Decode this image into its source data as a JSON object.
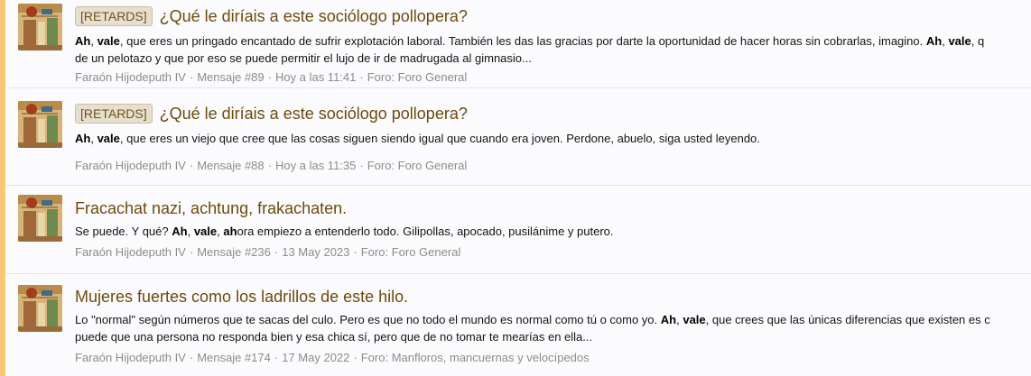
{
  "results": [
    {
      "prefix": "[RETARDS]",
      "title": "¿Qué le diríais a este sociólogo pollopera?",
      "snippet_line1": [
        {
          "t": "Ah",
          "b": true
        },
        {
          "t": ", ",
          "b": false
        },
        {
          "t": "vale",
          "b": true
        },
        {
          "t": ", que eres un pringado encantado de sufrir explotación laboral. También les das las gracias por darte la oportunidad de hacer horas sin cobrarlas, imagino. ",
          "b": false
        },
        {
          "t": "Ah",
          "b": true
        },
        {
          "t": ", ",
          "b": false
        },
        {
          "t": "vale",
          "b": true
        },
        {
          "t": ", q",
          "b": false
        }
      ],
      "snippet_line2": [
        {
          "t": "de un pelotazo y que por eso se puede permitir el lujo de ir de madrugada al gimnasio...",
          "b": false
        }
      ],
      "author": "Faraón Hijodeputh IV",
      "message": "Mensaje #89",
      "date": "Hoy a las 11:41",
      "forum": "Foro: Foro General"
    },
    {
      "prefix": "[RETARDS]",
      "title": "¿Qué le diríais a este sociólogo pollopera?",
      "snippet_line1": [
        {
          "t": "Ah",
          "b": true
        },
        {
          "t": ", ",
          "b": false
        },
        {
          "t": "vale",
          "b": true
        },
        {
          "t": ", que eres un viejo que cree que las cosas siguen siendo igual que cuando era joven. Perdone, abuelo, siga usted leyendo.",
          "b": false
        }
      ],
      "snippet_line2": [],
      "author": "Faraón Hijodeputh IV",
      "message": "Mensaje #88",
      "date": "Hoy a las 11:35",
      "forum": "Foro: Foro General"
    },
    {
      "prefix": "",
      "title": "Fracachat nazi, achtung, frakachaten.",
      "snippet_line1": [
        {
          "t": "Se puede. Y qué? ",
          "b": false
        },
        {
          "t": "Ah",
          "b": true
        },
        {
          "t": ", ",
          "b": false
        },
        {
          "t": "vale",
          "b": true
        },
        {
          "t": ", ",
          "b": false
        },
        {
          "t": "ah",
          "b": true
        },
        {
          "t": "ora empiezo a entenderlo todo. Gilipollas, apocado, pusilánime y putero.",
          "b": false
        }
      ],
      "snippet_line2": [],
      "author": "Faraón Hijodeputh IV",
      "message": "Mensaje #236",
      "date": "13 May 2023",
      "forum": "Foro: Foro General"
    },
    {
      "prefix": "",
      "title": "Mujeres fuertes como los ladrillos de este hilo.",
      "snippet_line1": [
        {
          "t": "Lo \"normal\" según números que te sacas del culo. Pero es que no todo el mundo es normal como tú o como yo. ",
          "b": false
        },
        {
          "t": "Ah",
          "b": true
        },
        {
          "t": ", ",
          "b": false
        },
        {
          "t": "vale",
          "b": true
        },
        {
          "t": ", que crees que las únicas diferencias que existen es c",
          "b": false
        }
      ],
      "snippet_line2": [
        {
          "t": "puede que una persona no responda bien y esa chica sí, pero que de no tomar te mearías en ella...",
          "b": false
        }
      ],
      "author": "Faraón Hijodeputh IV",
      "message": "Mensaje #174",
      "date": "17 May 2022",
      "forum": "Foro: Manfloros, mancuernas y velocípedos"
    }
  ],
  "meta_separator": "·",
  "colors": {
    "stripe": "#f7c873",
    "title": "#6d4a0b",
    "prefix_bg": "#e6dfcf",
    "meta": "#8c8c8c",
    "row_bg": "#fbfbfe",
    "divider": "#e3e3ee"
  },
  "avatar_icon": "pharaoh-avatar-icon"
}
